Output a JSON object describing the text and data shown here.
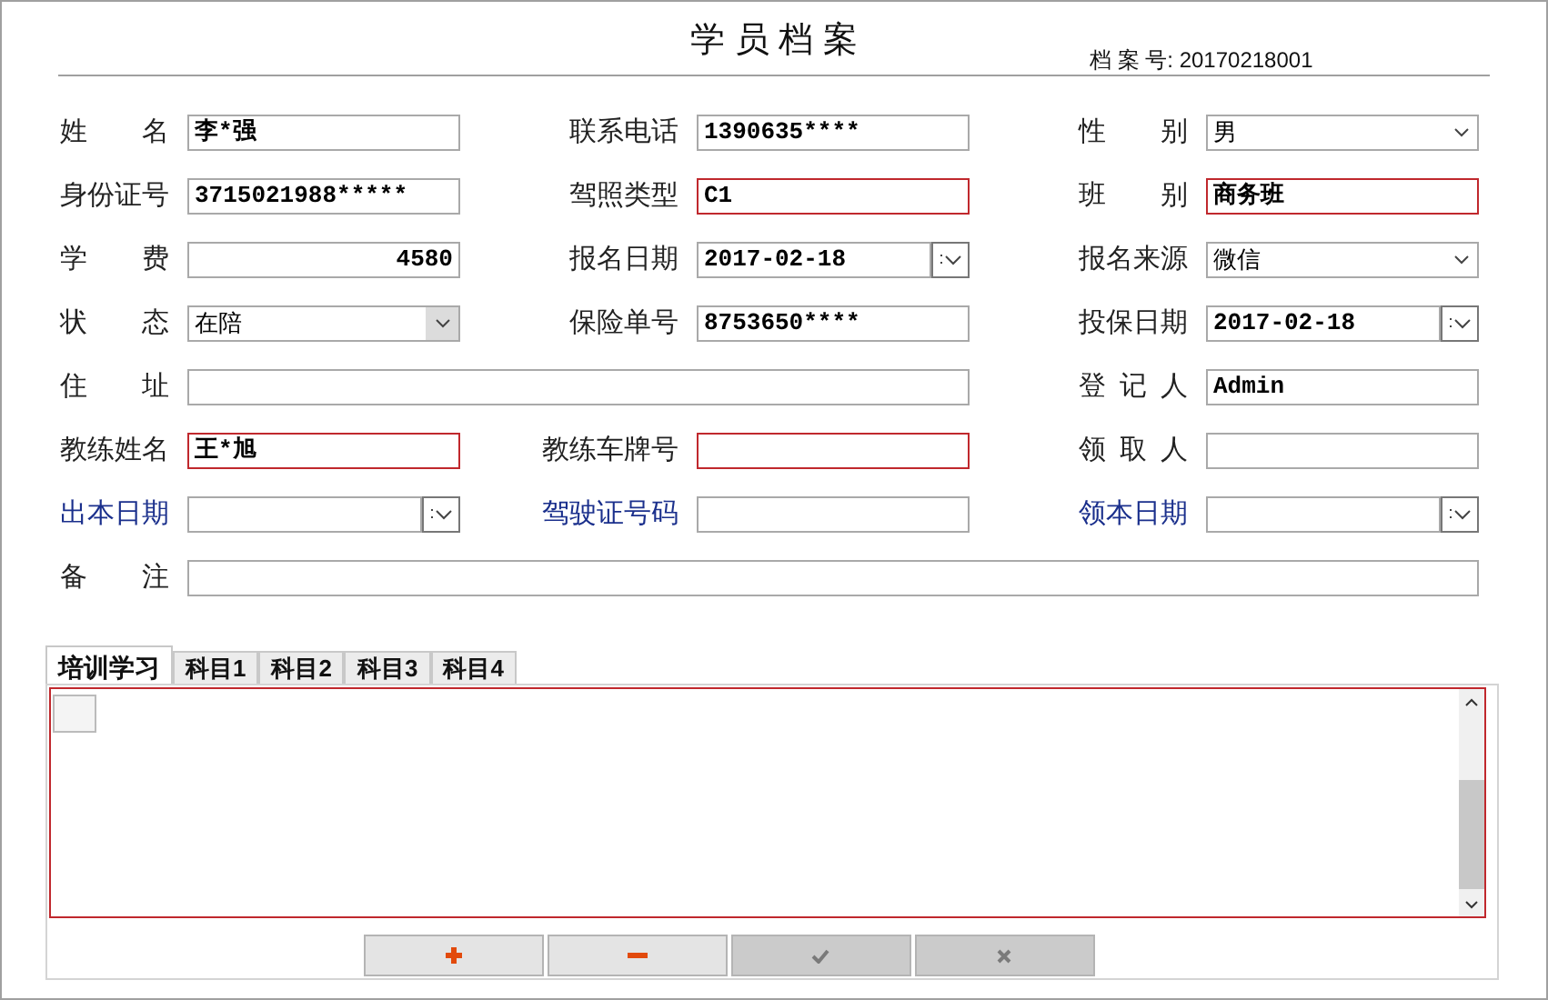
{
  "header": {
    "title": "学 员 档 案",
    "archive_number": "档 案 号: 20170218001"
  },
  "rows": [
    {
      "fields": [
        {
          "label": "姓 名",
          "value": "李*强",
          "kind": "text",
          "required": false,
          "label_link": false
        },
        {
          "label": "联系电话",
          "value": "1390635****",
          "kind": "text",
          "required": false,
          "label_link": false
        },
        {
          "label": "性 别",
          "value": "男",
          "kind": "select",
          "required": false,
          "label_link": false
        }
      ]
    },
    {
      "fields": [
        {
          "label": "身份证号",
          "value": "3715021988*****",
          "kind": "text",
          "required": false,
          "label_link": false
        },
        {
          "label": "驾照类型",
          "value": "C1",
          "kind": "text",
          "required": true,
          "label_link": false
        },
        {
          "label": "班 别",
          "value": "商务班",
          "kind": "text",
          "required": true,
          "label_link": false
        }
      ]
    },
    {
      "fields": [
        {
          "label": "学 费",
          "value": "4580",
          "kind": "number",
          "required": false,
          "label_link": false
        },
        {
          "label": "报名日期",
          "value": "2017-02-18",
          "kind": "date",
          "required": false,
          "label_link": false
        },
        {
          "label": "报名来源",
          "value": "微信",
          "kind": "select",
          "required": false,
          "label_link": false
        }
      ]
    },
    {
      "fields": [
        {
          "label": "状 态",
          "value": "在陪",
          "kind": "dropdown",
          "required": false,
          "label_link": false
        },
        {
          "label": "保险单号",
          "value": "8753650****",
          "kind": "text",
          "required": false,
          "label_link": false
        },
        {
          "label": "投保日期",
          "value": "2017-02-18",
          "kind": "date",
          "required": false,
          "label_link": false
        }
      ]
    },
    {
      "fields": [
        {
          "label": "住 址",
          "kind": "wide",
          "required": false,
          "label_link": false
        },
        {
          "label": "登 记 人",
          "value": "Admin",
          "kind": "text",
          "required": false,
          "label_link": false
        }
      ]
    },
    {
      "fields": [
        {
          "label": "教练姓名",
          "value": "王*旭",
          "kind": "text",
          "required": true,
          "label_link": false
        },
        {
          "label": "教练车牌号",
          "kind": "text",
          "required": true,
          "label_link": false
        },
        {
          "label": "领 取 人",
          "kind": "text",
          "required": false,
          "label_link": false
        }
      ]
    },
    {
      "fields": [
        {
          "label": "出本日期",
          "kind": "date",
          "required": false,
          "label_link": true
        },
        {
          "label": "驾驶证号码",
          "kind": "text",
          "required": false,
          "label_link": true
        },
        {
          "label": "领本日期",
          "kind": "date",
          "required": false,
          "label_link": true
        }
      ]
    },
    {
      "fields": [
        {
          "label": "备 注",
          "kind": "full",
          "required": false,
          "label_link": false
        }
      ]
    }
  ],
  "tabs": [
    {
      "label": "培训学习",
      "selected": true
    },
    {
      "label": "科目1",
      "selected": false
    },
    {
      "label": "科目2",
      "selected": false
    },
    {
      "label": "科目3",
      "selected": false
    },
    {
      "label": "科目4",
      "selected": false
    }
  ],
  "toolbar": [
    {
      "kind": "add",
      "disabled": false
    },
    {
      "kind": "remove",
      "disabled": false
    },
    {
      "kind": "confirm",
      "disabled": true
    },
    {
      "kind": "cancel",
      "disabled": true
    }
  ]
}
